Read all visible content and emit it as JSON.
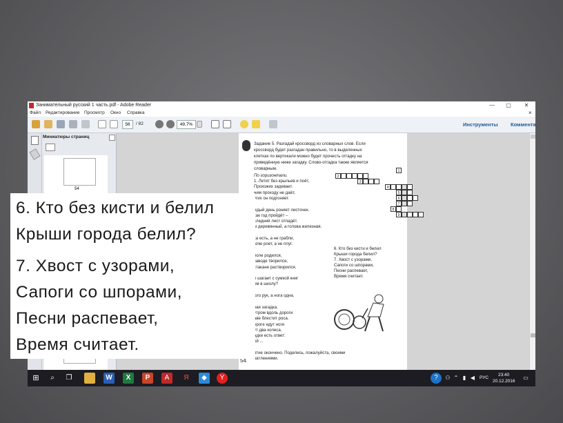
{
  "window": {
    "title": "Занимательный русский 1 часть.pdf - Adobe Reader",
    "menu": [
      "Файл",
      "Редактирование",
      "Просмотр",
      "Окно",
      "Справка"
    ],
    "controls": {
      "minimize": "—",
      "maximize": "▢",
      "close": "✕",
      "doc_close": "×"
    }
  },
  "toolbar": {
    "page_current": "56",
    "page_total": "/ 82",
    "zoom": "49,7%",
    "tools_label": "Инструменты",
    "comments_label": "Комментарии"
  },
  "sidebar": {
    "title": "Миниатюры страниц",
    "page_label": "54"
  },
  "document": {
    "task_lines": [
      "Задание 5. Разгадай кроссворд из словарных слов. Если",
      "кроссворд будет разгадан правильно, то в выделенных",
      "клетках по вертикали можно будет прочесть отгадку на",
      "приведённую ниже загадку. Слово-отгадка также является",
      "словарным."
    ],
    "horizontal_heading": "По горизонтали.",
    "clues": [
      "1. Летит без крыльев и поёт,",
      "    Прохожих задевает.",
      "      ним проходу не даёт,",
      "      угих он подгоняет.",
      "",
      "     ждый день роняет листочек.",
      "      как год пройдёт –",
      "      следний лист отпадёт.",
      "      м деревянный, а голова железная.",
      "",
      "     ка есть, а не грабли,",
      "     млю роет, а не плуг.",
      "",
      "      поле родился,",
      "      заводе творился,",
      "      стакане растворился.",
      "",
      "      о шагает с сумкой книг",
      "      ом в школу?",
      "",
      "      юго рук, а нога одна.",
      "",
      "      вая загадка.",
      "      утром вдоль дороги",
      "      аве блестит роса.",
      "      орогe едут ноги",
      "      ут два колеса.",
      "      адки есть ответ:",
      "      ой ...",
      "",
      "      ятие окончено. Поделись, пожалуйста, своими",
      "      чатлениями."
    ],
    "crossword_numbers": [
      "1",
      "2",
      "3",
      "4",
      "5",
      "6",
      "7",
      "8",
      "9"
    ],
    "right_riddle": [
      "6. Кто без кисти и белил",
      "    Крыши города белил?",
      "7. Хвост с узорами,",
      "    Сапоги со шпорами,",
      "    Песни распевает,",
      "    Время считает."
    ],
    "page_number": "54"
  },
  "zoom_overlay": {
    "lines": [
      "6. Кто без кисти и белил",
      "    Крыши города белил?",
      "7. Хвост с узорами,",
      "    Сапоги со шпорами,",
      "    Песни распевает,",
      "    Время считает."
    ]
  },
  "taskbar": {
    "lang": "РУС",
    "time": "23:40",
    "date": "20.12.2016"
  }
}
